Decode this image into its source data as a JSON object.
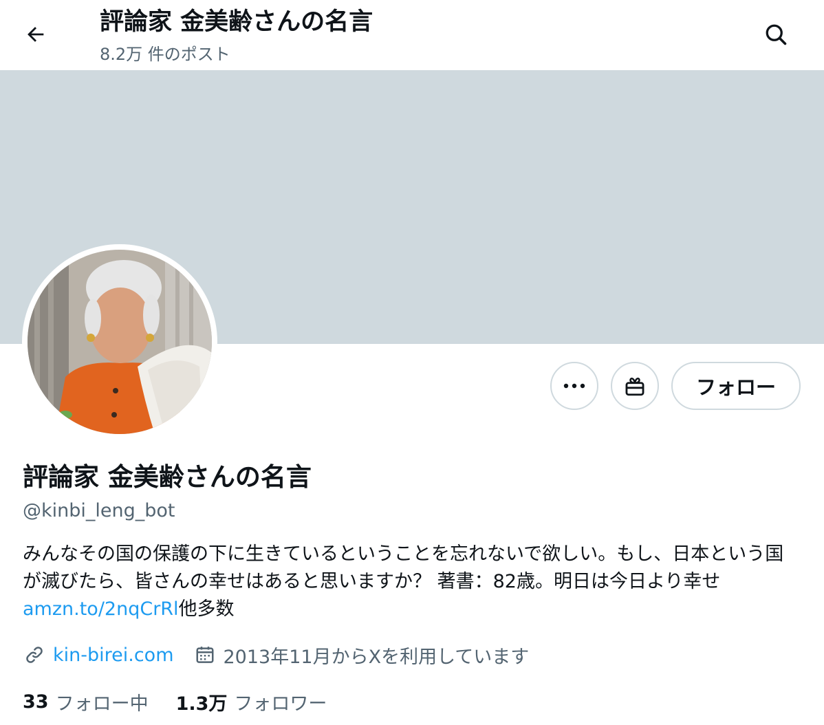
{
  "header": {
    "title": "評論家 金美齢さんの名言",
    "post_count": "8.2万 件のポスト",
    "back_icon": "arrow-left-icon",
    "search_icon": "search-icon"
  },
  "banner": {
    "color": "#cfd9de"
  },
  "profile": {
    "avatar_icon": "profile-photo",
    "display_name": "評論家 金美齢さんの名言",
    "handle": "@kinbi_leng_bot",
    "bio_text_1": "みんなその国の保護の下に生きているということを忘れないで欲しい。もし、日本という国が滅びたら、皆さんの幸せはあると思いますか？ 著書：82歳。明日は今日より幸せ",
    "bio_link": "amzn.to/2nqCrRl",
    "bio_text_2": "他多数",
    "website": "kin-birei.com",
    "joined": "2013年11月からXを利用しています"
  },
  "actions": {
    "more_icon": "ellipsis-icon",
    "gift_icon": "gift-icon",
    "follow_label": "フォロー"
  },
  "stats": {
    "following_count": "33",
    "following_label": "フォロー中",
    "followers_count": "1.3万",
    "followers_label": "フォロワー"
  },
  "colors": {
    "link": "#1d9bf0",
    "secondary_text": "#536471",
    "primary_text": "#0f1419",
    "border": "#cfd9de"
  }
}
